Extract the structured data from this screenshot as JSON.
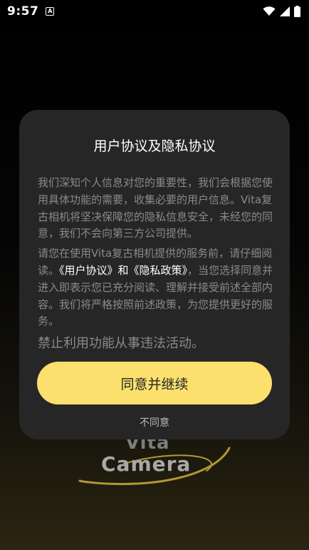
{
  "status_bar": {
    "time": "9:57",
    "app_icon_glyph": "A",
    "icons": [
      "wifi-icon",
      "signal-icon",
      "battery-icon"
    ]
  },
  "logo": {
    "line1": "Vita",
    "line2": "Camera"
  },
  "dialog": {
    "title": "用户协议及隐私协议",
    "para1": "我们深知个人信息对您的重要性，我们会根据您使用具体功能的需要，收集必要的用户信息。Vita复古相机将坚决保障您的隐私信息安全，未经您的同意，我们不会向第三方公司提供。",
    "para2_prefix": "请您在使用Vita复古相机提供的服务前，请仔细阅读。",
    "user_agreement_link": "《用户协议》",
    "and_text": "和",
    "privacy_policy_link": "《隐私政策》",
    "para2_suffix": "，当您选择同意并进入即表示您已充分阅读、理解并接受前述全部内容。我们将严格按照前述政策，为您提供更好的服务。",
    "para3": "禁止利用功能从事违法活动。",
    "agree_label": "同意并继续",
    "disagree_label": "不同意"
  },
  "colors": {
    "accent": "#fbe06d",
    "dialog_bg": "#262626",
    "body_text": "#8a8a8a",
    "link_text": "#ffffff"
  }
}
